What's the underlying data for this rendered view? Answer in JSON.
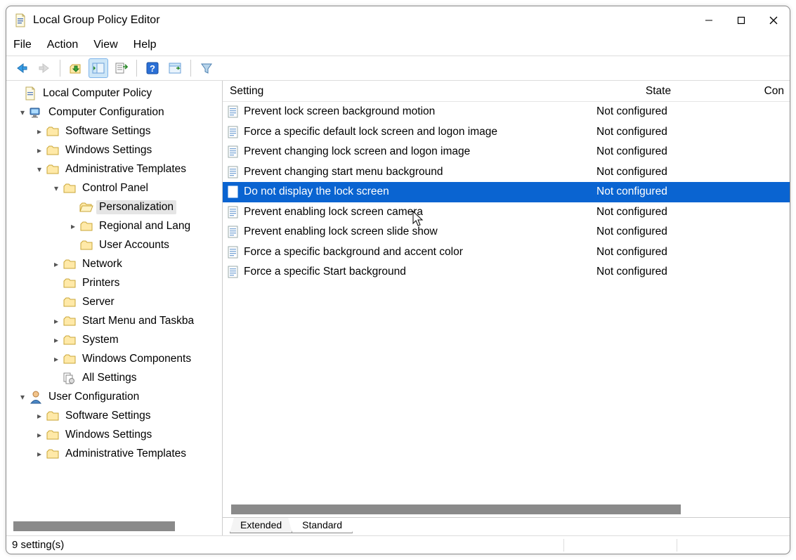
{
  "window": {
    "title": "Local Group Policy Editor"
  },
  "menu": {
    "file": "File",
    "action": "Action",
    "view": "View",
    "help": "Help"
  },
  "tree": {
    "root": "Local Computer Policy",
    "computer_config": "Computer Configuration",
    "cc_software": "Software Settings",
    "cc_windows": "Windows Settings",
    "cc_admin": "Administrative Templates",
    "control_panel": "Control Panel",
    "personalization": "Personalization",
    "regional": "Regional and Lang",
    "user_accounts": "User Accounts",
    "network": "Network",
    "printers": "Printers",
    "server": "Server",
    "start_menu": "Start Menu and Taskba",
    "system": "System",
    "win_components": "Windows Components",
    "all_settings": "All Settings",
    "user_config": "User Configuration",
    "uc_software": "Software Settings",
    "uc_windows": "Windows Settings",
    "uc_admin": "Administrative Templates"
  },
  "columns": {
    "setting": "Setting",
    "state": "State",
    "con": "Con"
  },
  "settings": [
    {
      "name": "Prevent lock screen background motion",
      "state": "Not configured",
      "selected": false
    },
    {
      "name": "Force a specific default lock screen and logon image",
      "state": "Not configured",
      "selected": false
    },
    {
      "name": "Prevent changing lock screen and logon image",
      "state": "Not configured",
      "selected": false
    },
    {
      "name": "Prevent changing start menu background",
      "state": "Not configured",
      "selected": false
    },
    {
      "name": "Do not display the lock screen",
      "state": "Not configured",
      "selected": true
    },
    {
      "name": "Prevent enabling lock screen camera",
      "state": "Not configured",
      "selected": false
    },
    {
      "name": "Prevent enabling lock screen slide show",
      "state": "Not configured",
      "selected": false
    },
    {
      "name": "Force a specific background and accent color",
      "state": "Not configured",
      "selected": false
    },
    {
      "name": "Force a specific Start background",
      "state": "Not configured",
      "selected": false
    }
  ],
  "tabs": {
    "extended": "Extended",
    "standard": "Standard"
  },
  "status": {
    "count": "9 setting(s)"
  }
}
